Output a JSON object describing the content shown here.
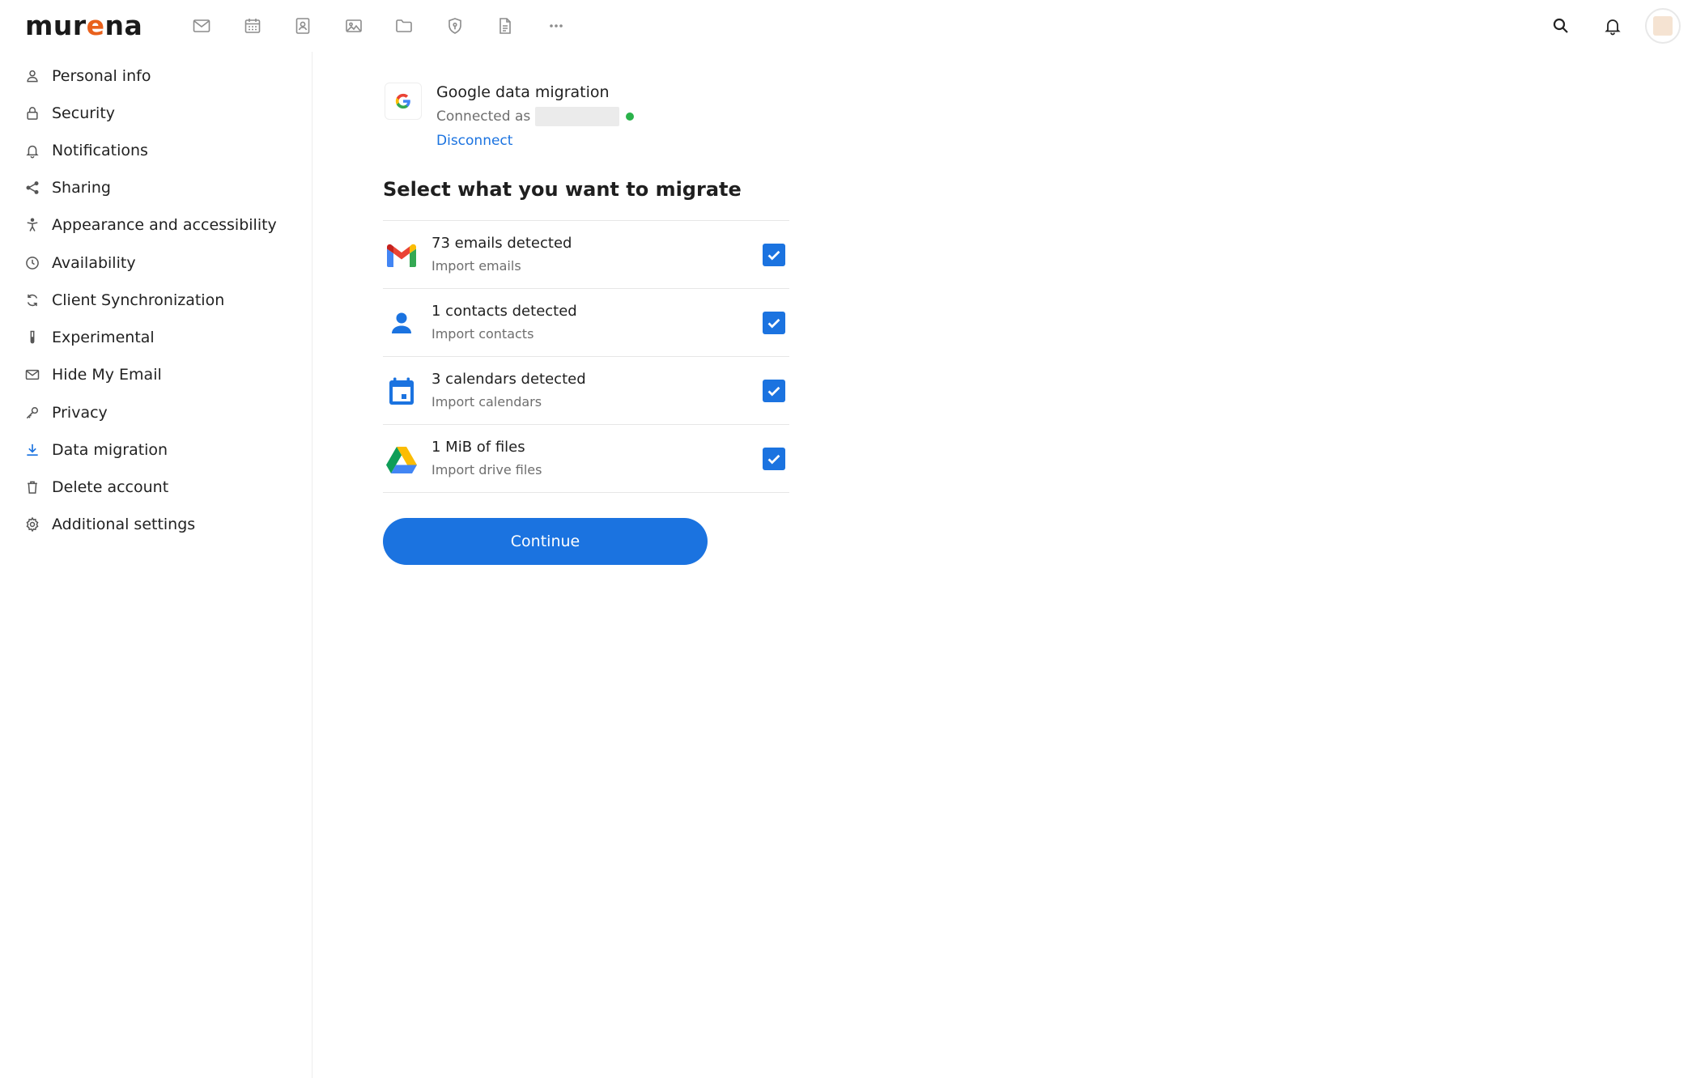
{
  "header": {
    "logo_parts": [
      "mur",
      "e",
      "na"
    ],
    "apps": [
      {
        "icon": "mail-icon",
        "name": "app-mail"
      },
      {
        "icon": "calendar-icon",
        "name": "app-calendar"
      },
      {
        "icon": "contacts-icon",
        "name": "app-contacts"
      },
      {
        "icon": "photos-icon",
        "name": "app-photos"
      },
      {
        "icon": "files-icon",
        "name": "app-files"
      },
      {
        "icon": "passwords-icon",
        "name": "app-passwords"
      },
      {
        "icon": "notes-icon",
        "name": "app-notes"
      },
      {
        "icon": "more-icon",
        "name": "app-more"
      }
    ],
    "right": [
      {
        "icon": "search-icon"
      },
      {
        "icon": "bell-icon"
      },
      {
        "icon": "avatar"
      }
    ]
  },
  "sidebar": {
    "items": [
      {
        "label": "Personal info",
        "icon": "user-icon"
      },
      {
        "label": "Security",
        "icon": "lock-icon"
      },
      {
        "label": "Notifications",
        "icon": "bell-icon"
      },
      {
        "label": "Sharing",
        "icon": "share-icon"
      },
      {
        "label": "Appearance and accessibility",
        "icon": "accessibility-icon"
      },
      {
        "label": "Availability",
        "icon": "clock-icon"
      },
      {
        "label": "Client Synchronization",
        "icon": "sync-icon"
      },
      {
        "label": "Experimental",
        "icon": "test-tube-icon"
      },
      {
        "label": "Hide My Email",
        "icon": "mail-icon"
      },
      {
        "label": "Privacy",
        "icon": "key-icon"
      },
      {
        "label": "Data migration",
        "icon": "download-icon",
        "active": true
      },
      {
        "label": "Delete account",
        "icon": "trash-icon"
      },
      {
        "label": "Additional settings",
        "icon": "gear-icon"
      }
    ]
  },
  "main": {
    "google": {
      "title": "Google data migration",
      "connected_label": "Connected as",
      "disconnect": "Disconnect",
      "status_color": "#2ab24a"
    },
    "section_title": "Select what you want to migrate",
    "items": [
      {
        "title": "73 emails detected",
        "subtitle": "Import emails",
        "icon": "gmail-icon",
        "checked": true
      },
      {
        "title": "1 contacts detected",
        "subtitle": "Import contacts",
        "icon": "contacts-person-icon",
        "checked": true
      },
      {
        "title": "3 calendars detected",
        "subtitle": "Import calendars",
        "icon": "calendar-icon",
        "checked": true
      },
      {
        "title": "1 MiB of files",
        "subtitle": "Import drive files",
        "icon": "drive-icon",
        "checked": true
      }
    ],
    "continue_label": "Continue"
  },
  "colors": {
    "accent": "#1b73e0",
    "logo_accent": "#e9611c"
  }
}
